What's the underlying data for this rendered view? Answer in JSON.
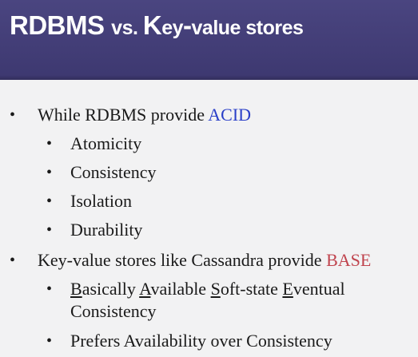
{
  "slide": {
    "title_parts": [
      "RDBMS ",
      "vs. ",
      "K",
      "ey",
      "-",
      "value stores"
    ],
    "items": [
      {
        "level": 1,
        "text": "While RDBMS provide ",
        "highlight": "ACID"
      },
      {
        "level": 2,
        "text": "Atomicity"
      },
      {
        "level": 2,
        "text": "Consistency"
      },
      {
        "level": 2,
        "text": "Isolation"
      },
      {
        "level": 2,
        "text": "Durability"
      },
      {
        "level": 1,
        "text": "Key-value stores like Cassandra provide ",
        "highlight": "BASE"
      },
      {
        "level": 2,
        "base_words": [
          {
            "initial": "B",
            "rest": "asically "
          },
          {
            "initial": "A",
            "rest": "vailable "
          },
          {
            "initial": "S",
            "rest": "oft-state "
          },
          {
            "initial": "E",
            "rest": "ventual"
          }
        ],
        "continuation": "Consistency"
      },
      {
        "level": 2,
        "text": "Prefers Availability over Consistency"
      }
    ],
    "bullet_char": "•",
    "colors": {
      "header_bg": "#443f78",
      "acid": "#2a3fc8",
      "base": "#c0444e",
      "body_bg": "#f2f2f3"
    }
  }
}
